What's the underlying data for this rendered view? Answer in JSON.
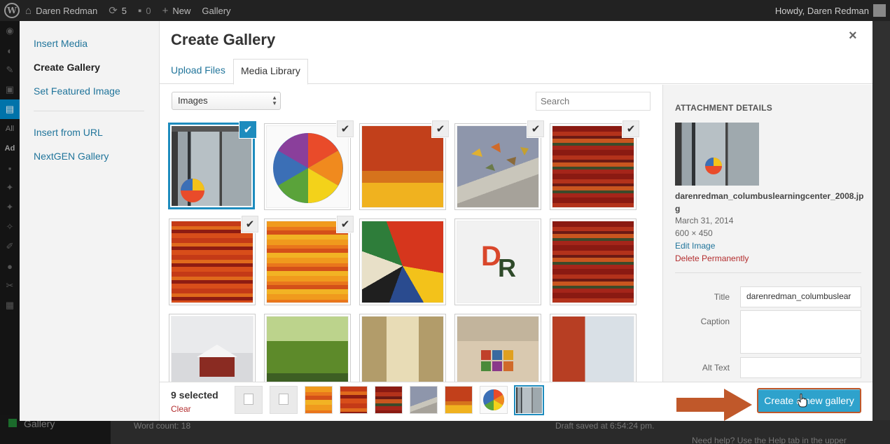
{
  "adminbar": {
    "site_name": "Daren Redman",
    "updates_count": "5",
    "comments_count": "0",
    "new_label": "New",
    "gallery_label": "Gallery",
    "howdy": "Howdy, Daren Redman"
  },
  "background": {
    "side_labels": [
      "All",
      "Ad"
    ],
    "menu_gallery": "Gallery",
    "word_count": "Word count: 18",
    "draft_saved": "Draft saved at 6:54:24 pm.",
    "help_text": "Need help? Use the Help tab in the upper"
  },
  "modal": {
    "menu": {
      "insert_media": "Insert Media",
      "create_gallery": "Create Gallery",
      "set_featured": "Set Featured Image",
      "insert_url": "Insert from URL",
      "nextgen": "NextGEN Gallery"
    },
    "title": "Create Gallery",
    "close": "×",
    "tabs": {
      "upload": "Upload Files",
      "library": "Media Library"
    },
    "filter_select": "Images",
    "search_placeholder": "Search",
    "checkmark": "✔"
  },
  "sidebar": {
    "header": "ATTACHMENT DETAILS",
    "filename": "darenredman_columbuslearningcenter_2008.jpg",
    "date": "March 31, 2014",
    "dimensions": "600 × 450",
    "edit_image": "Edit Image",
    "delete": "Delete Permanently",
    "title_label": "Title",
    "title_value": "darenredman_columbuslear",
    "caption_label": "Caption",
    "caption_value": "",
    "alt_label": "Alt Text",
    "alt_value": ""
  },
  "bottom": {
    "selected_count": "9 selected",
    "clear": "Clear",
    "create_button": "Create a new gallery"
  },
  "dr_logo": {
    "d": "D",
    "r": "R"
  },
  "colors": {
    "accent": "#1e8cbe",
    "link": "#21759b",
    "danger": "#b32d2e",
    "arrow": "#c0582a",
    "button": "#2ea2cc"
  }
}
